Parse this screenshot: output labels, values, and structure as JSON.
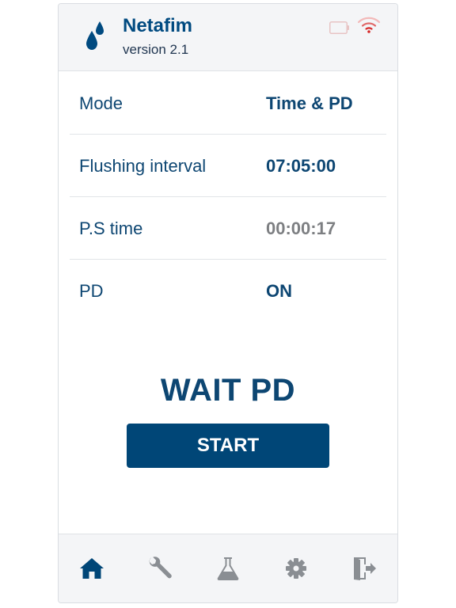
{
  "header": {
    "app_name": "Netafim",
    "version": "version 2.1",
    "logo_icon": "water-drops-icon",
    "battery_icon": "battery-icon",
    "wifi_icon": "wifi-icon"
  },
  "settings": [
    {
      "label": "Mode",
      "value": "Time & PD",
      "muted": false
    },
    {
      "label": "Flushing interval",
      "value": "07:05:00",
      "muted": false
    },
    {
      "label": "P.S time",
      "value": "00:00:17",
      "muted": true
    },
    {
      "label": "PD",
      "value": "ON",
      "muted": false
    }
  ],
  "status": {
    "text": "WAIT PD"
  },
  "actions": {
    "start_label": "START"
  },
  "nav": [
    {
      "icon": "home-icon",
      "active": true
    },
    {
      "icon": "wrench-icon",
      "active": false
    },
    {
      "icon": "flask-icon",
      "active": false
    },
    {
      "icon": "gear-icon",
      "active": false
    },
    {
      "icon": "exit-icon",
      "active": false
    }
  ],
  "colors": {
    "primary": "#004677",
    "text": "#0d4672",
    "muted_value": "#7d7f82",
    "inactive_icon": "#8a8e93",
    "wifi_signal": "#d62828",
    "header_bg": "#f4f5f7"
  }
}
